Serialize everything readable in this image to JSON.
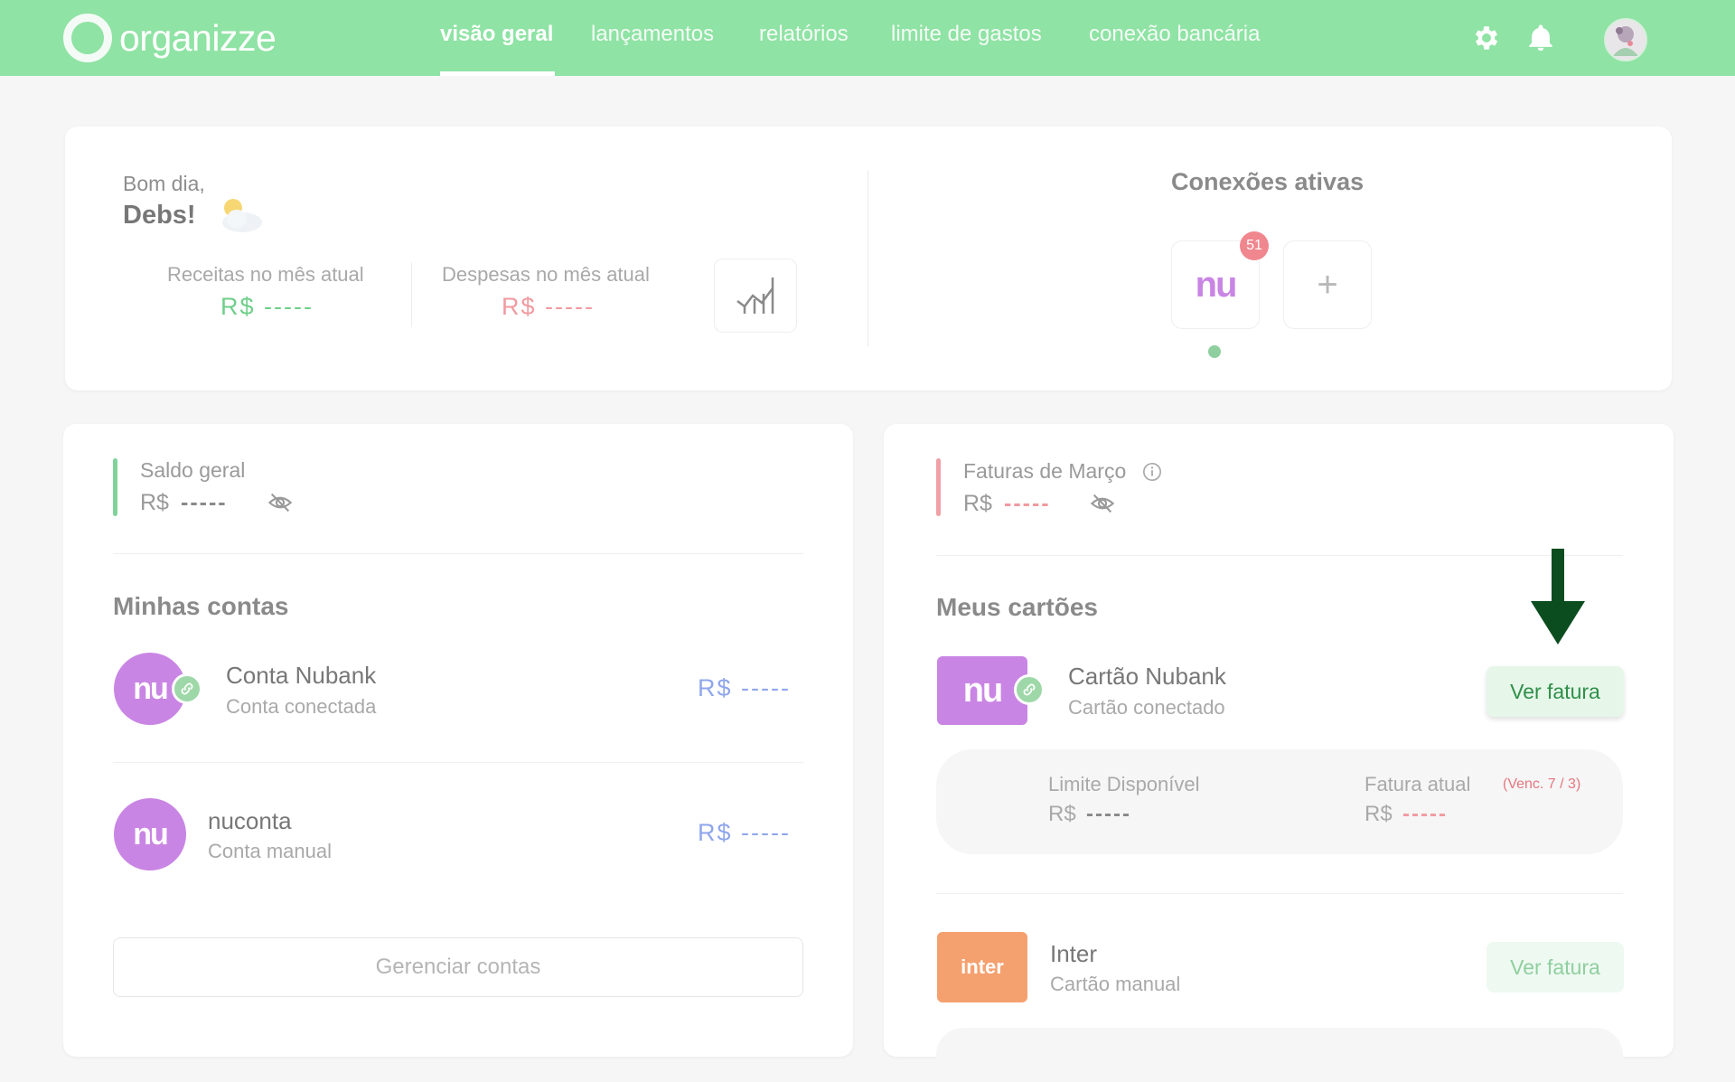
{
  "app": {
    "logo_text": "organizze"
  },
  "nav": {
    "items": [
      {
        "label": "visão geral",
        "active": true
      },
      {
        "label": "lançamentos"
      },
      {
        "label": "relatórios"
      },
      {
        "label": "limite de gastos"
      },
      {
        "label": "conexão bancária"
      }
    ],
    "icons": [
      "gear-icon",
      "bell-icon",
      "avatar"
    ]
  },
  "greeting": {
    "hello": "Bom dia,",
    "name": "Debs!",
    "weather_icon": "sun-cloud-icon",
    "income_label": "Receitas no mês atual",
    "income_value": "R$ -----",
    "expense_label": "Despesas no mês atual",
    "expense_value": "R$ -----",
    "chart_button_icon": "chart-icon"
  },
  "connections": {
    "title": "Conexões ativas",
    "bank_logo": "nu",
    "badge_count": "51",
    "add_symbol": "+"
  },
  "accounts": {
    "balance_label": "Saldo geral",
    "balance_currency": "R$",
    "balance_value": "-----",
    "section_title": "Minhas contas",
    "items": [
      {
        "logo": "nu",
        "name": "Conta Nubank",
        "subtitle": "Conta conectada",
        "value": "R$ -----"
      },
      {
        "logo": "nu",
        "name": "nuconta",
        "subtitle": "Conta manual",
        "value": "R$ -----"
      }
    ],
    "manage_button": "Gerenciar contas"
  },
  "cards": {
    "invoices_label": "Faturas de Março",
    "invoices_currency": "R$",
    "invoices_value": "-----",
    "section_title": "Meus cartões",
    "items": [
      {
        "logo": "nu",
        "name": "Cartão Nubank",
        "subtitle": "Cartão conectado",
        "button": "Ver fatura",
        "limit_label": "Limite Disponível",
        "limit_currency": "R$",
        "limit_value": "-----",
        "invoice_label": "Fatura atual",
        "invoice_due": "(Venc. 7 / 3)",
        "invoice_currency": "R$",
        "invoice_value": "-----"
      },
      {
        "logo": "inter",
        "name": "Inter",
        "subtitle": "Cartão manual",
        "button": "Ver fatura"
      }
    ]
  },
  "colors": {
    "brand_green": "#8fe3a4",
    "income_green": "#6fcf8a",
    "expense_red": "#f19aa0",
    "nubank_purple": "#c985e4",
    "inter_orange": "#f5a06f",
    "value_blue": "#8fa6ec",
    "arrow_green": "#0b4d1f"
  }
}
